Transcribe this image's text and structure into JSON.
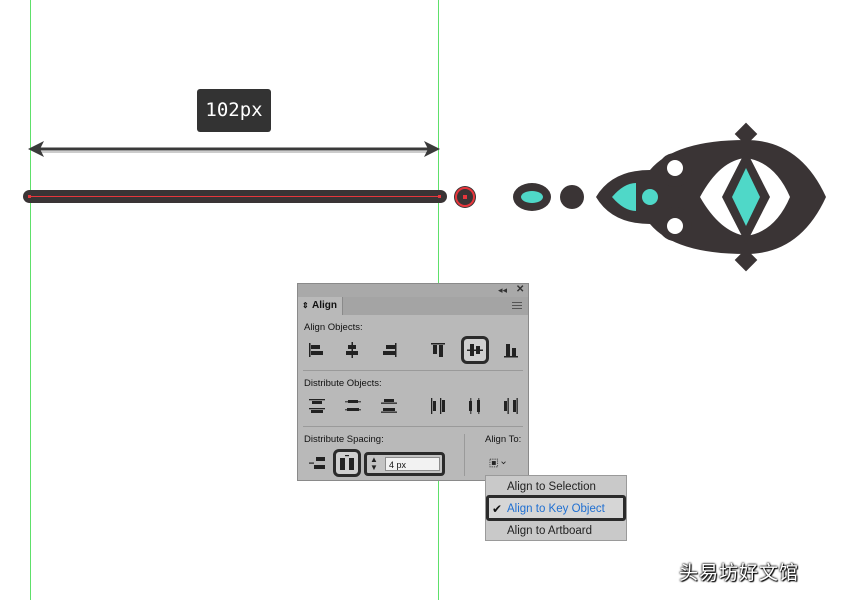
{
  "measure": {
    "label": "102px"
  },
  "colors": {
    "dark": "#3a3435",
    "teal": "#4fd8c8",
    "guide": "#5ee06a",
    "red_outline": "#e8363c"
  },
  "align_panel": {
    "tab_label": "Align",
    "collapse_glyph": "◂◂",
    "close_glyph": "✕",
    "align_objects_label": "Align Objects:",
    "distribute_objects_label": "Distribute Objects:",
    "distribute_spacing_label": "Distribute Spacing:",
    "align_to_label": "Align To:",
    "spacing_value": "4 px",
    "align_objects_icons": [
      "horizontal-align-left-icon",
      "horizontal-align-center-icon",
      "horizontal-align-right-icon",
      "vertical-align-top-icon",
      "vertical-align-center-icon",
      "vertical-align-bottom-icon"
    ],
    "active_align": "vertical-align-center-icon"
  },
  "align_to_menu": {
    "items": [
      "Align to Selection",
      "Align to Key Object",
      "Align to Artboard"
    ],
    "selected": "Align to Key Object",
    "checkmark": "✔"
  },
  "watermark": {
    "text": "头易坊好文馆"
  }
}
